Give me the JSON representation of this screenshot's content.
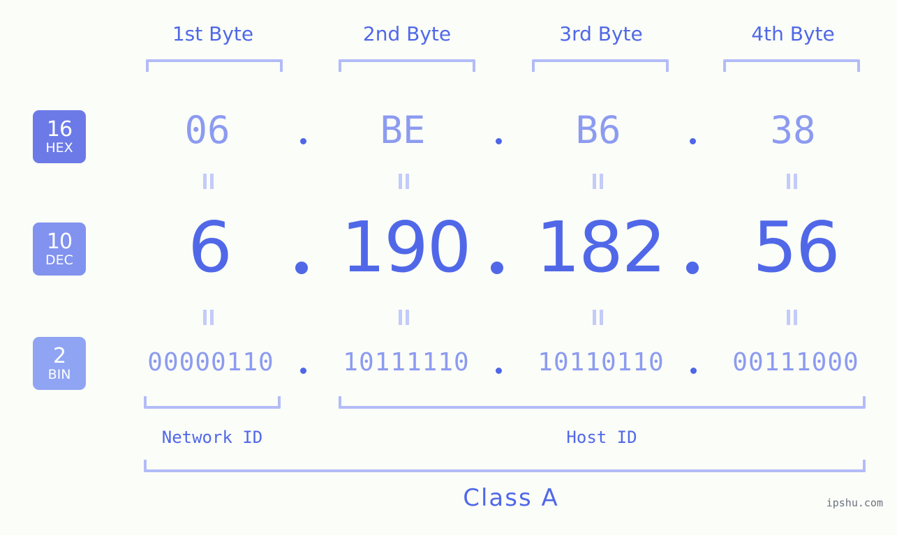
{
  "page": {
    "background_color": "#fbfdf8",
    "accent_color": "#5068e8",
    "light_accent_color": "#8c9bf0",
    "bracket_color": "#b3bcf7",
    "watermark": "ipshu.com"
  },
  "byte_headers": [
    {
      "label": "1st Byte"
    },
    {
      "label": "2nd Byte"
    },
    {
      "label": "3rd Byte"
    },
    {
      "label": "4th Byte"
    }
  ],
  "rows": [
    {
      "badge": {
        "number": "16",
        "name": "HEX",
        "color": "#6c7ae8"
      },
      "values": [
        "06",
        "BE",
        "B6",
        "38"
      ],
      "separator": "."
    },
    {
      "badge": {
        "number": "10",
        "name": "DEC",
        "color": "#8192ef"
      },
      "values": [
        "6",
        "190",
        "182",
        "56"
      ],
      "separator": "."
    },
    {
      "badge": {
        "number": "2",
        "name": "BIN",
        "color": "#8fa4f2"
      },
      "values": [
        "00000110",
        "10111110",
        "10110110",
        "00111000"
      ],
      "separator": "."
    }
  ],
  "equals_marks": {
    "symbol": "=",
    "count_per_row": 4,
    "rows": 2
  },
  "segments": {
    "network_id": {
      "label": "Network ID"
    },
    "host_id": {
      "label": "Host ID"
    },
    "class": {
      "label": "Class A"
    }
  }
}
